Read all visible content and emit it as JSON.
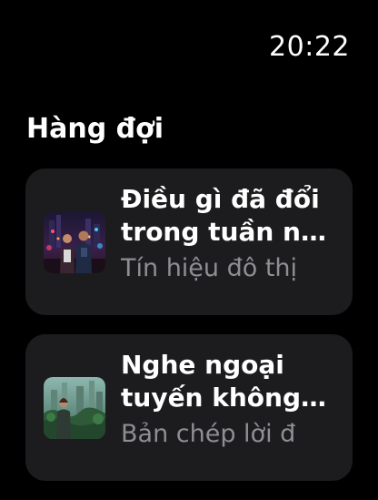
{
  "status": {
    "time": "20:22"
  },
  "page": {
    "title": "Hàng đợi"
  },
  "queue": {
    "items": [
      {
        "title": "Điều gì đã đổi trong tuần n…",
        "subtitle": "Tín hiệu đô thị",
        "artwork_icon": "podcast-artwork-city-night"
      },
      {
        "title": "Nghe ngoại tuyến không…",
        "subtitle": "Bản chép lời đ",
        "artwork_icon": "podcast-artwork-green-city"
      }
    ]
  },
  "colors": {
    "background": "#000000",
    "card": "#1c1c1e",
    "text_primary": "#ffffff",
    "text_secondary": "#8e8e93"
  }
}
